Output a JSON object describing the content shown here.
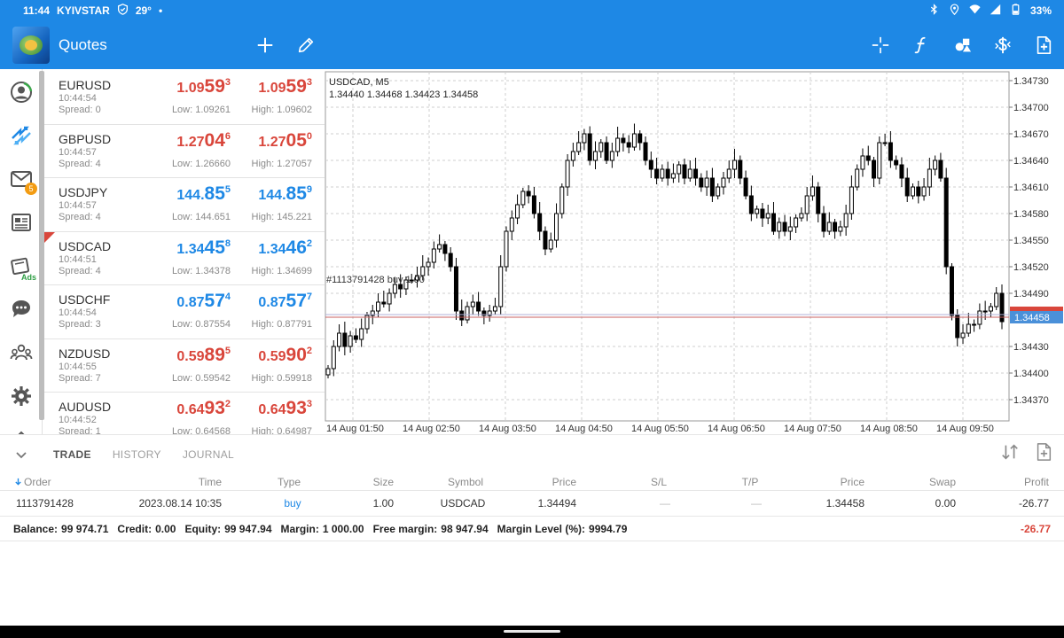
{
  "status": {
    "time": "11:44",
    "carrier": "KYIVSTAR",
    "temp": "29°",
    "dot": "•",
    "battery": "33%"
  },
  "appbar": {
    "title": "Quotes"
  },
  "nav": {
    "mail_badge": "5",
    "ads_label": "Ads"
  },
  "quotes": [
    {
      "symbol": "EURUSD",
      "time": "10:44:54",
      "spread": "Spread: 0",
      "bid": [
        "1.09",
        "59",
        "3"
      ],
      "ask": [
        "1.09",
        "59",
        "3"
      ],
      "low": "Low: 1.09261",
      "high": "High: 1.09602",
      "dir": "down",
      "flag": false
    },
    {
      "symbol": "GBPUSD",
      "time": "10:44:57",
      "spread": "Spread: 4",
      "bid": [
        "1.27",
        "04",
        "6"
      ],
      "ask": [
        "1.27",
        "05",
        "0"
      ],
      "low": "Low: 1.26660",
      "high": "High: 1.27057",
      "dir": "down",
      "flag": false
    },
    {
      "symbol": "USDJPY",
      "time": "10:44:57",
      "spread": "Spread: 4",
      "bid": [
        "144.",
        "85",
        "5"
      ],
      "ask": [
        "144.",
        "85",
        "9"
      ],
      "low": "Low: 144.651",
      "high": "High: 145.221",
      "dir": "up",
      "flag": false
    },
    {
      "symbol": "USDCAD",
      "time": "10:44:51",
      "spread": "Spread: 4",
      "bid": [
        "1.34",
        "45",
        "8"
      ],
      "ask": [
        "1.34",
        "46",
        "2"
      ],
      "low": "Low: 1.34378",
      "high": "High: 1.34699",
      "dir": "up",
      "flag": true
    },
    {
      "symbol": "USDCHF",
      "time": "10:44:54",
      "spread": "Spread: 3",
      "bid": [
        "0.87",
        "57",
        "4"
      ],
      "ask": [
        "0.87",
        "57",
        "7"
      ],
      "low": "Low: 0.87554",
      "high": "High: 0.87791",
      "dir": "up",
      "flag": false
    },
    {
      "symbol": "NZDUSD",
      "time": "10:44:55",
      "spread": "Spread: 7",
      "bid": [
        "0.59",
        "89",
        "5"
      ],
      "ask": [
        "0.59",
        "90",
        "2"
      ],
      "low": "Low: 0.59542",
      "high": "High: 0.59918",
      "dir": "down",
      "flag": false
    },
    {
      "symbol": "AUDUSD",
      "time": "10:44:52",
      "spread": "Spread: 1",
      "bid": [
        "0.64",
        "93",
        "2"
      ],
      "ask": [
        "0.64",
        "93",
        "3"
      ],
      "low": "Low: 0.64568",
      "high": "High: 0.64987",
      "dir": "down",
      "flag": false
    }
  ],
  "chart": {
    "symbol_tf": "USDCAD, M5",
    "ohlc": "1.34440 1.34468 1.34423 1.34458",
    "order_label": "#1113791428 buy 1.00",
    "price_tag": "1.34458",
    "y_ticks": [
      "1.34730",
      "1.34700",
      "1.34670",
      "1.34640",
      "1.34610",
      "1.34580",
      "1.34550",
      "1.34520",
      "1.34490",
      "1.34430",
      "1.34400",
      "1.34370"
    ],
    "x_ticks": [
      "14 Aug 01:50",
      "14 Aug 02:50",
      "14 Aug 03:50",
      "14 Aug 04:50",
      "14 Aug 05:50",
      "14 Aug 06:50",
      "14 Aug 07:50",
      "14 Aug 08:50",
      "14 Aug 09:50"
    ]
  },
  "tabs": {
    "trade": "TRADE",
    "history": "HISTORY",
    "journal": "JOURNAL"
  },
  "table": {
    "headers": {
      "order": "Order",
      "time": "Time",
      "type": "Type",
      "size": "Size",
      "symbol": "Symbol",
      "price": "Price",
      "sl": "S/L",
      "tp": "T/P",
      "price2": "Price",
      "swap": "Swap",
      "profit": "Profit"
    },
    "row": {
      "order": "1113791428",
      "time": "2023.08.14 10:35",
      "type": "buy",
      "size": "1.00",
      "symbol": "USDCAD",
      "price": "1.34494",
      "sl": "—",
      "tp": "—",
      "price2": "1.34458",
      "swap": "0.00",
      "profit": "-26.77"
    }
  },
  "balance": {
    "balance_label": "Balance:",
    "balance": "99 974.71",
    "credit_label": "Credit:",
    "credit": "0.00",
    "equity_label": "Equity:",
    "equity": "99 947.94",
    "margin_label": "Margin:",
    "margin": "1 000.00",
    "free_margin_label": "Free margin:",
    "free_margin": "98 947.94",
    "margin_level_label": "Margin Level (%):",
    "margin_level": "9994.79",
    "profit": "-26.77"
  },
  "colors": {
    "accent": "#1e88e5",
    "down": "#d9463b",
    "up": "#1e88e5",
    "price_tag_bg": "#4a90d9"
  }
}
